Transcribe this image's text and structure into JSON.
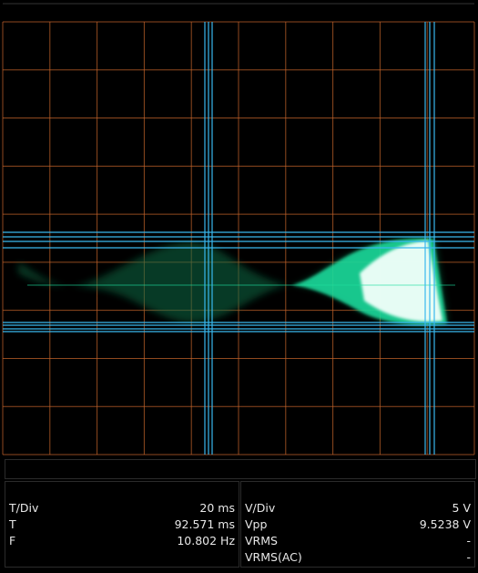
{
  "colors": {
    "background": "#000000",
    "grid": "#c0622a",
    "cursor": "#39b8ee",
    "trace": "#1fe0a0",
    "trace_core": "#f2fffa"
  },
  "scope": {
    "grid_divisions": {
      "horizontal": 10,
      "vertical": 9
    },
    "cursors": {
      "vertical_group_1": 3,
      "vertical_group_2": 3,
      "horizontal_group_1": 4,
      "horizontal_group_2": 4
    },
    "signal": {
      "shape": "amplitude-modulated burst",
      "trace_color": "green"
    }
  },
  "time_panel": {
    "rows": [
      {
        "label": "T/Div",
        "value": "20 ms"
      },
      {
        "label": "T",
        "value": "92.571 ms"
      },
      {
        "label": "F",
        "value": "10.802 Hz"
      }
    ]
  },
  "volt_panel": {
    "rows": [
      {
        "label": "V/Div",
        "value": "5 V"
      },
      {
        "label": "Vpp",
        "value": "9.5238 V"
      },
      {
        "label": "VRMS",
        "value": "-"
      },
      {
        "label": "VRMS(AC)",
        "value": "-"
      }
    ]
  }
}
